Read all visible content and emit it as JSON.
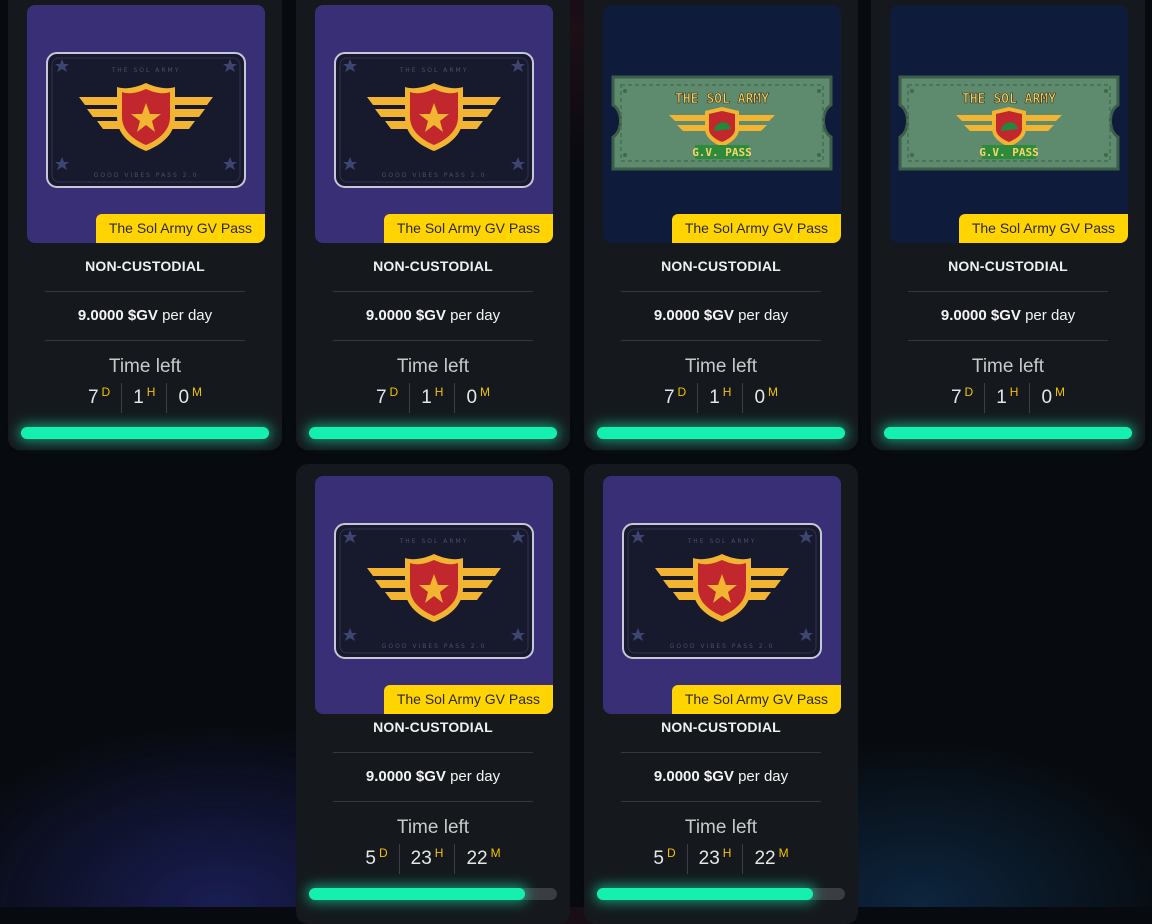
{
  "colors": {
    "tag_bg": "#ffd400",
    "accent_progress": "#14f0b0",
    "unit_color": "#f2c200",
    "card_bg": "#15191d"
  },
  "cards": [
    {
      "name": "The Sol Army GV Pass",
      "art": "gold-wings-shield",
      "custody": "NON-CUSTODIAL",
      "rate_amount": "9.0000 $GV",
      "rate_suffix": "per day",
      "time_left_label": "Time left",
      "days": "7",
      "hours": "1",
      "minutes": "0",
      "unit_d": "D",
      "unit_h": "H",
      "unit_m": "M",
      "progress": 1.0,
      "top_text": "THE SOL ARMY",
      "bottom_text": "GOOD VIBES PASS 2.0"
    },
    {
      "name": "The Sol Army GV Pass",
      "art": "gold-wings-shield",
      "custody": "NON-CUSTODIAL",
      "rate_amount": "9.0000 $GV",
      "rate_suffix": "per day",
      "time_left_label": "Time left",
      "days": "7",
      "hours": "1",
      "minutes": "0",
      "unit_d": "D",
      "unit_h": "H",
      "unit_m": "M",
      "progress": 1.0,
      "top_text": "THE SOL ARMY",
      "bottom_text": "GOOD VIBES PASS 2.0"
    },
    {
      "name": "The Sol Army GV Pass",
      "art": "pixel-ticket",
      "custody": "NON-CUSTODIAL",
      "rate_amount": "9.0000 $GV",
      "rate_suffix": "per day",
      "time_left_label": "Time left",
      "days": "7",
      "hours": "1",
      "minutes": "0",
      "unit_d": "D",
      "unit_h": "H",
      "unit_m": "M",
      "progress": 1.0,
      "top_text": "THE SOL ARMY",
      "bottom_text": "G.V. PASS"
    },
    {
      "name": "The Sol Army GV Pass",
      "art": "pixel-ticket",
      "custody": "NON-CUSTODIAL",
      "rate_amount": "9.0000 $GV",
      "rate_suffix": "per day",
      "time_left_label": "Time left",
      "days": "7",
      "hours": "1",
      "minutes": "0",
      "unit_d": "D",
      "unit_h": "H",
      "unit_m": "M",
      "progress": 1.0,
      "top_text": "THE SOL ARMY",
      "bottom_text": "G.V. PASS"
    },
    {
      "name": "The Sol Army GV Pass",
      "art": "gold-wings-shield",
      "custody": "NON-CUSTODIAL",
      "rate_amount": "9.0000 $GV",
      "rate_suffix": "per day",
      "time_left_label": "Time left",
      "days": "5",
      "hours": "23",
      "minutes": "22",
      "unit_d": "D",
      "unit_h": "H",
      "unit_m": "M",
      "progress": 0.87,
      "top_text": "THE SOL ARMY",
      "bottom_text": "GOOD VIBES PASS 2.0"
    },
    {
      "name": "The Sol Army GV Pass",
      "art": "gold-wings-shield",
      "custody": "NON-CUSTODIAL",
      "rate_amount": "9.0000 $GV",
      "rate_suffix": "per day",
      "time_left_label": "Time left",
      "days": "5",
      "hours": "23",
      "minutes": "22",
      "unit_d": "D",
      "unit_h": "H",
      "unit_m": "M",
      "progress": 0.87,
      "top_text": "THE SOL ARMY",
      "bottom_text": "GOOD VIBES PASS 2.0"
    }
  ]
}
